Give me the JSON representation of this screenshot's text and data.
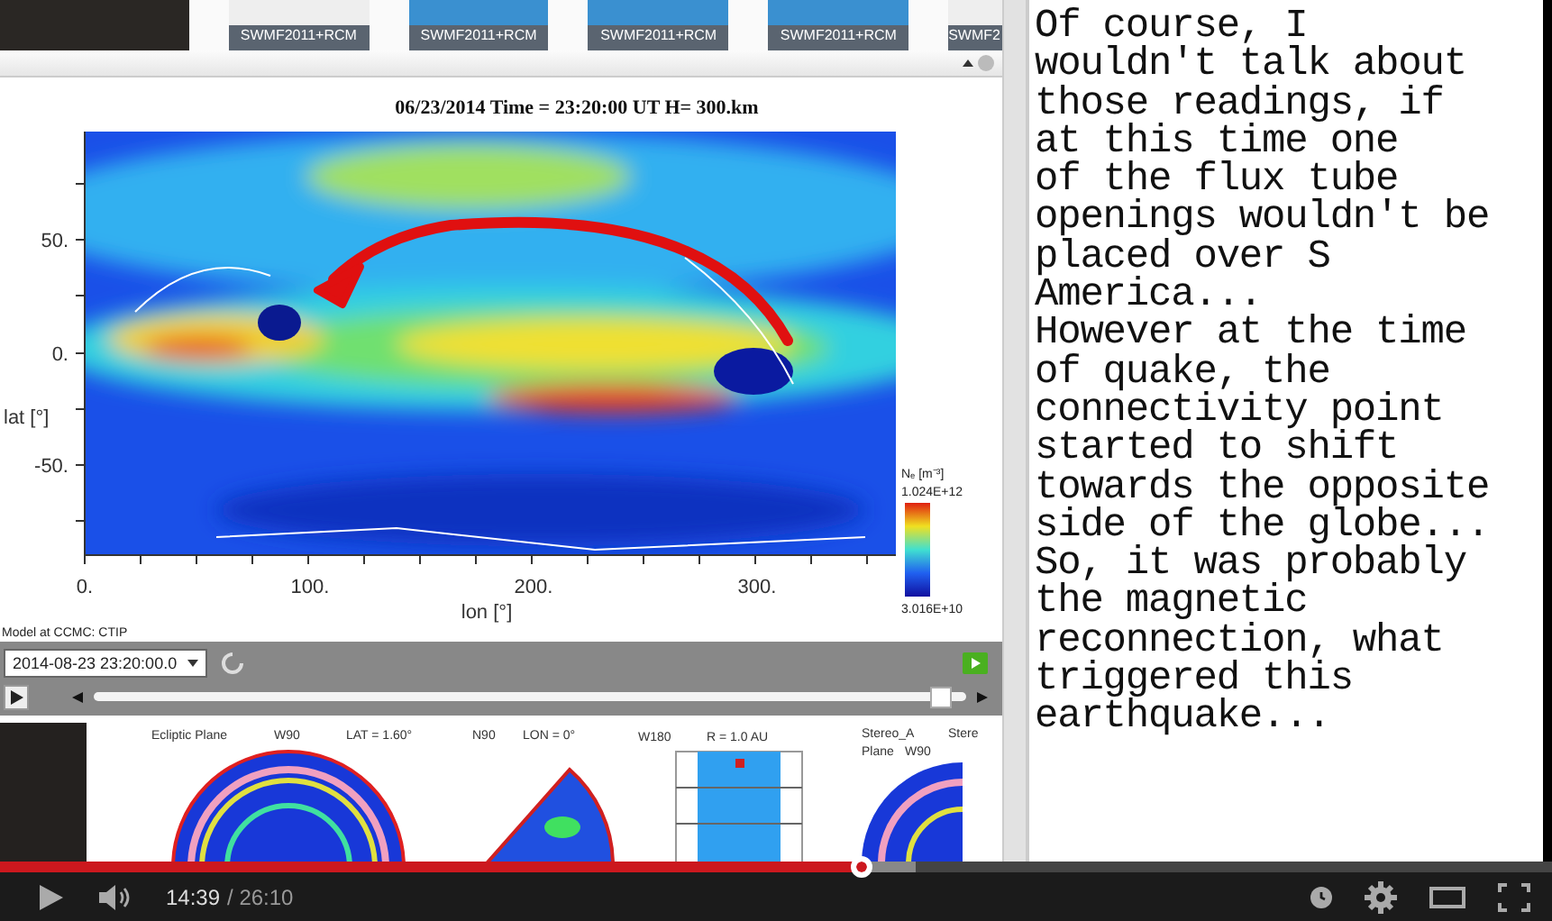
{
  "thumbnails": [
    {
      "label": "SWMF2011+RCM"
    },
    {
      "label": "SWMF2011+RCM"
    },
    {
      "label": "SWMF2011+RCM"
    },
    {
      "label": "SWMF2011+RCM"
    },
    {
      "label": "SWMF2"
    }
  ],
  "plot": {
    "title": "06/23/2014 Time = 23:20:00 UT H= 300.km",
    "y_ticks": [
      "50.",
      "0.",
      "-50."
    ],
    "y_label": "lat [°]",
    "x_ticks": [
      "0.",
      "100.",
      "200.",
      "300."
    ],
    "x_label": "lon [°]",
    "colorbar_label": "Nₑ [m⁻³]",
    "colorbar_max": "1.024E+12",
    "colorbar_min": "3.016E+10",
    "footer": "Model at CCMC: CTIP"
  },
  "time_select": {
    "value": "2014-08-23 23:20:00.0"
  },
  "timeline": {
    "level": 0.97
  },
  "bottom_plots": [
    {
      "labels": [
        "Ecliptic Plane",
        "W90",
        "LAT = 1.60°"
      ]
    },
    {
      "labels": [
        "N90",
        "LON = 0°"
      ]
    },
    {
      "labels": [
        "W180",
        "R = 1.0 AU"
      ]
    },
    {
      "labels": [
        "Stereo_A",
        "Stere",
        "Plane",
        "W90"
      ]
    }
  ],
  "caption_lines": [
    "Of course, I",
    "wouldn't talk about",
    "those readings, if",
    "at this time one",
    "of the flux tube",
    "openings wouldn't be",
    "placed over S",
    "America...",
    "However at the time",
    "of quake, the",
    "connectivity point",
    "started to shift",
    "towards the opposite",
    "side of the globe...",
    "So, it was probably",
    "the magnetic",
    "reconnection, what",
    "triggered this",
    "earthquake..."
  ],
  "player": {
    "progress": {
      "level": 0.555
    },
    "current_time": "14:39",
    "duration": "/ 26:10"
  }
}
